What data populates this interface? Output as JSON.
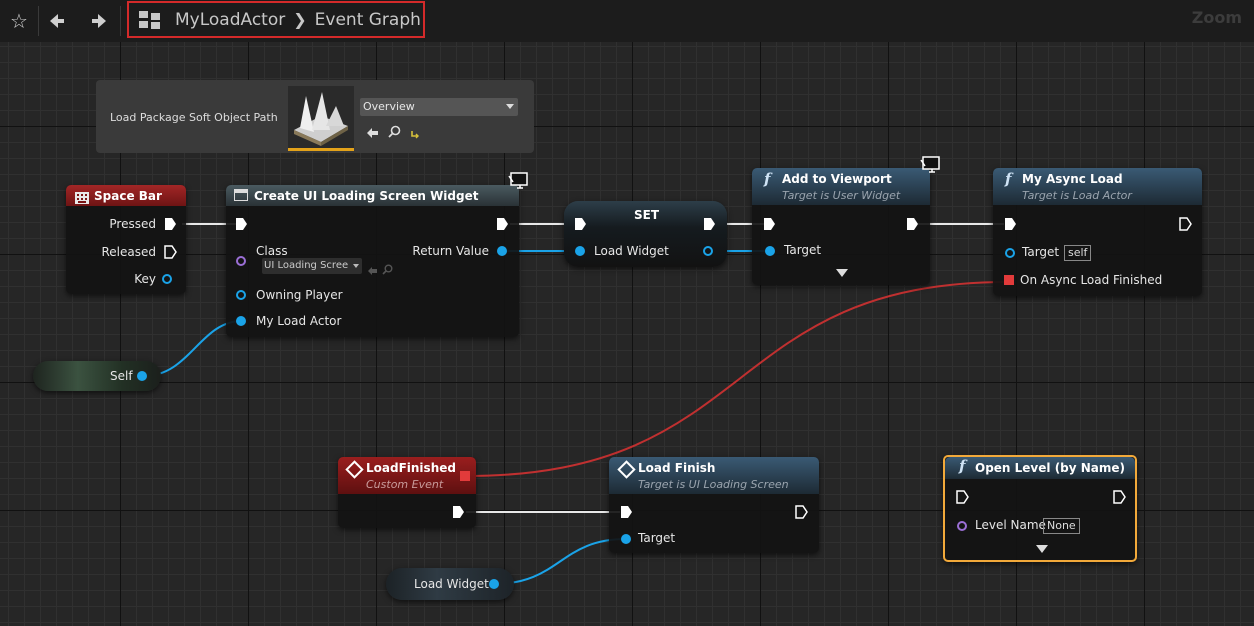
{
  "toolbar": {
    "breadcrumb_asset": "MyLoadActor",
    "breadcrumb_graph": "Event Graph",
    "zoom_label": "Zoom"
  },
  "asset_panel": {
    "label": "Load Package Soft Object Path",
    "dropdown_value": "Overview"
  },
  "nodes": {
    "space_bar": {
      "title": "Space Bar",
      "pressed": "Pressed",
      "released": "Released",
      "key": "Key"
    },
    "create_widget": {
      "title": "Create UI Loading Screen Widget",
      "class_label": "Class",
      "class_value": "UI Loading Scree",
      "return_value": "Return Value",
      "owning_player": "Owning Player",
      "my_load_actor": "My Load Actor"
    },
    "set": {
      "title": "SET",
      "load_widget": "Load Widget"
    },
    "add_viewport": {
      "title": "Add to Viewport",
      "subtitle": "Target is User Widget",
      "target": "Target"
    },
    "async_load": {
      "title": "My Async Load",
      "subtitle": "Target is Load Actor",
      "target": "Target",
      "target_value": "self",
      "on_finished": "On Async Load Finished"
    },
    "self_var": {
      "label": "Self"
    },
    "load_finished": {
      "title": "LoadFinished",
      "subtitle": "Custom Event"
    },
    "load_finish": {
      "title": "Load Finish",
      "subtitle": "Target is UI Loading Screen",
      "target": "Target"
    },
    "load_widget_var": {
      "label": "Load Widget"
    },
    "open_level": {
      "title": "Open Level (by Name)",
      "level_name": "Level Name",
      "level_value": "None"
    }
  },
  "colors": {
    "exec_wire": "#e8e8e8",
    "object_wire": "#1aa3e8",
    "delegate_wire": "#c03030",
    "selection": "#f2a93a",
    "event_header": "#8e1a1a",
    "function_header": "#2f4a60"
  }
}
